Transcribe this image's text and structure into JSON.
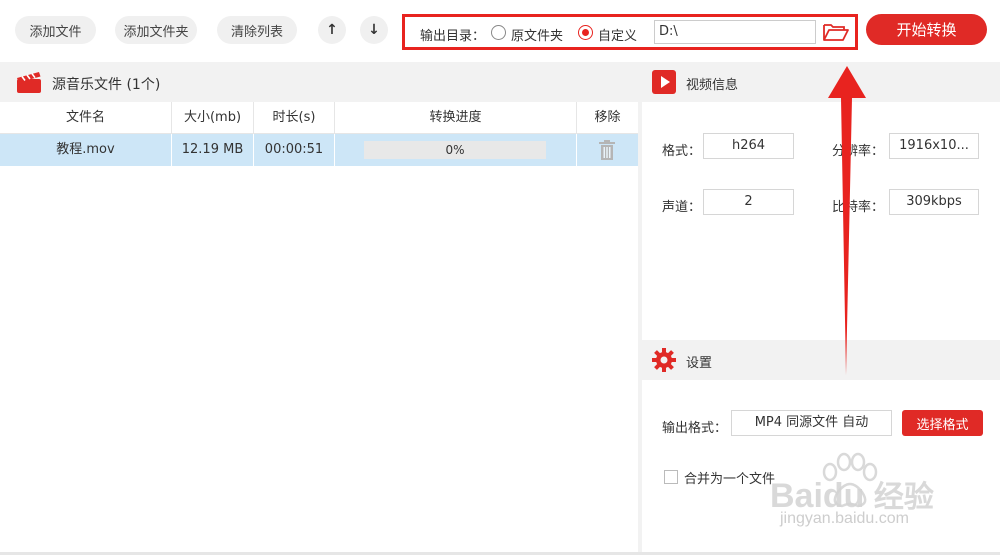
{
  "toolbar": {
    "add_file": "添加文件",
    "add_folder": "添加文件夹",
    "clear_list": "清除列表",
    "move_up_icon": "↑",
    "move_down_icon": "↓",
    "output_dir_label": "输出目录：",
    "option_source_folder": "原文件夹",
    "option_custom": "自定义",
    "selected_option": "自定义",
    "path_value": "D:\\",
    "start_button": "开始转换"
  },
  "file_list": {
    "title": "源音乐文件 (1个)",
    "columns": [
      "文件名",
      "大小(mb)",
      "时长(s)",
      "转换进度",
      "移除"
    ],
    "rows": [
      {
        "name": "教程.mov",
        "size": "12.19 MB",
        "duration": "00:00:51",
        "progress_text": "0%",
        "progress_value": 0
      }
    ]
  },
  "video_info": {
    "title": "视频信息",
    "format_label": "格式：",
    "format_value": "h264",
    "resolution_label": "分辨率：",
    "resolution_value": "1916x10...",
    "channel_label": "声道：",
    "channel_value": "2",
    "bitrate_label": "比特率：",
    "bitrate_value": "309kbps"
  },
  "settings": {
    "title": "设置",
    "output_format_label": "输出格式：",
    "output_format_value": "MP4 同源文件 自动",
    "select_format_button": "选择格式",
    "merge_label": "合并为一个文件",
    "merge_checked": false
  },
  "watermark": {
    "brand": "Baidu",
    "brand_cn": "经验",
    "url": "jingyan.baidu.com"
  },
  "colors": {
    "accent": "#e02a26",
    "annotation": "#e8231f",
    "row_selected": "#cde6f7",
    "panel_header": "#f2f2f2"
  },
  "icons": {
    "file_list_logo": "clapperboard-icon",
    "folder": "folder-open-icon",
    "remove": "trash-icon",
    "video_info": "play-icon",
    "settings": "gear-icon"
  }
}
